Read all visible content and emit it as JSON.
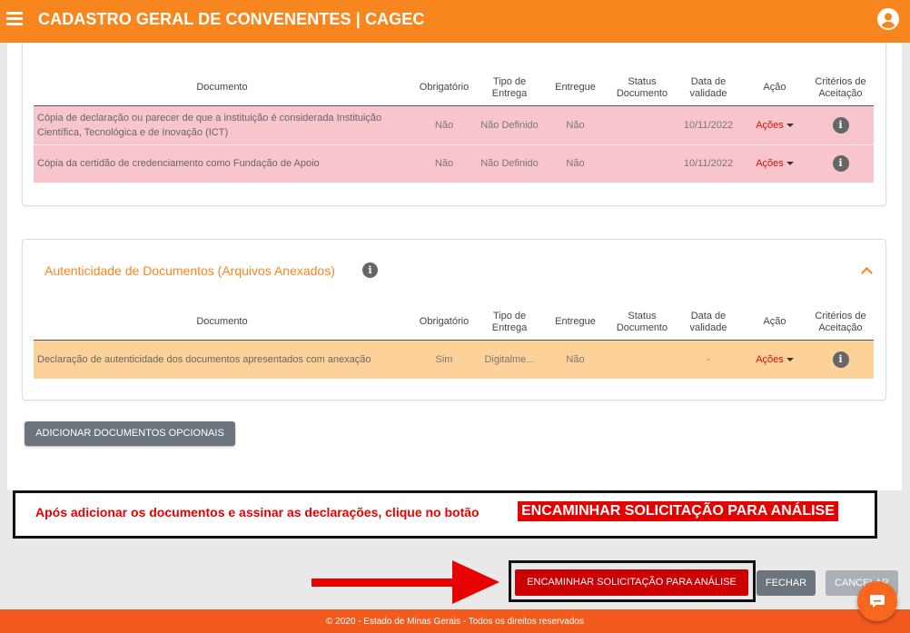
{
  "header": {
    "title": "CADASTRO GERAL DE CONVENENTES | CAGEC",
    "menu_icon": "hamburger-icon",
    "user_icon": "user-circle-icon"
  },
  "colors": {
    "primary": "#f7861e",
    "footer": "#f35a1e",
    "danger": "#cc0000",
    "row_pink": "#f9c5cc",
    "row_orange": "#fdd29a"
  },
  "columns": [
    "Documento",
    "Obrigatório",
    "Tipo de Entrega",
    "Entregue",
    "Status Documento",
    "Data de validade",
    "Ação",
    "Critérios de Aceitação"
  ],
  "table1": {
    "rows": [
      {
        "documento": "Cópia de declaração ou parecer  de que a instituição é considerada Instituição Científica, Tecnológica e de Inovação (ICT)",
        "obrigatorio": "Não",
        "tipo_entrega": "Não Definido",
        "entregue": "Não",
        "status": "",
        "validade": "10/11/2022",
        "acao": "Ações"
      },
      {
        "documento": "Cópia da certidão de credenciamento como Fundação de Apoio",
        "obrigatorio": "Não",
        "tipo_entrega": "Não Definido",
        "entregue": "Não",
        "status": "",
        "validade": "10/11/2022",
        "acao": "Ações"
      }
    ]
  },
  "section2": {
    "title": "Autenticidade de Documentos (Arquivos Anexados)",
    "rows": [
      {
        "documento": "Declaração de autenticidade dos documentos apresentados com anexação",
        "obrigatorio": "Sim",
        "tipo_entrega": "Digitalme...",
        "entregue": "Não",
        "status": "",
        "validade": "-",
        "acao": "Ações"
      }
    ]
  },
  "buttons": {
    "opcionais": "ADICIONAR DOCUMENTOS OPCIONAIS",
    "encaminhar": "ENCAMINHAR SOLICITAÇÃO PARA ANÁLISE",
    "fechar": "FECHAR",
    "cancelar": "CANCELAR"
  },
  "notice": {
    "text": "Após adicionar os documentos e assinar as declarações, clique no botão",
    "highlight": "ENCAMINHAR SOLICITAÇÃO PARA ANÁLISE"
  },
  "footer": {
    "text": "© 2020 - Estado de Minas Gerais - Todos os direitos reservados"
  }
}
